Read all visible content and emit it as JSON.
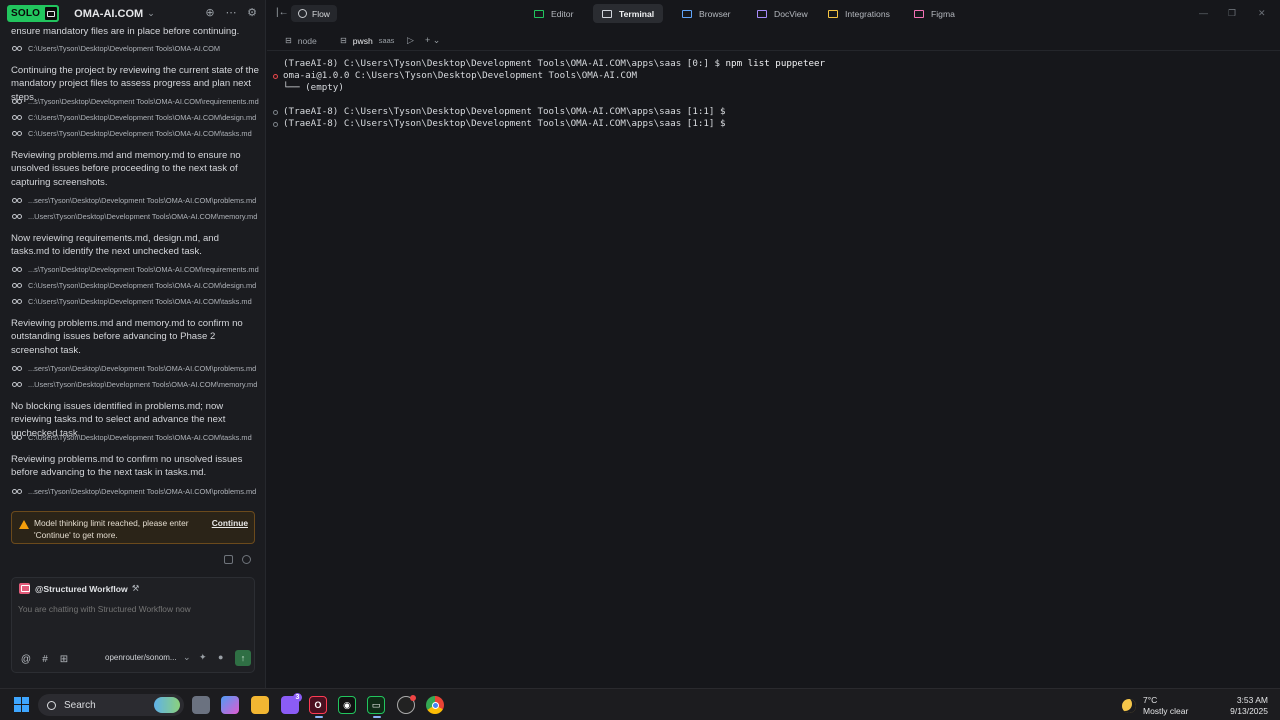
{
  "sidebar": {
    "badge": "SOLO",
    "project": "OMA-AI.COM",
    "messages": [
      {
        "type": "text",
        "text": "ensure mandatory files are in place before continuing."
      },
      {
        "type": "file",
        "path": "C:\\Users\\Tyson\\Desktop\\Development Tools\\OMA-AI.COM"
      },
      {
        "type": "text",
        "text": "Continuing the project by reviewing the current state of the mandatory project files to assess progress and plan next steps."
      },
      {
        "type": "file",
        "path": "...s\\Tyson\\Desktop\\Development Tools\\OMA-AI.COM\\requirements.md"
      },
      {
        "type": "file",
        "path": "C:\\Users\\Tyson\\Desktop\\Development Tools\\OMA-AI.COM\\design.md"
      },
      {
        "type": "file",
        "path": "C:\\Users\\Tyson\\Desktop\\Development Tools\\OMA-AI.COM\\tasks.md"
      },
      {
        "type": "text",
        "text": "Reviewing problems.md and memory.md to ensure no unsolved issues before proceeding to the next task of capturing screenshots."
      },
      {
        "type": "file",
        "path": "...sers\\Tyson\\Desktop\\Development Tools\\OMA-AI.COM\\problems.md"
      },
      {
        "type": "file",
        "path": "...Users\\Tyson\\Desktop\\Development Tools\\OMA-AI.COM\\memory.md"
      },
      {
        "type": "text",
        "text": "Now reviewing requirements.md, design.md, and tasks.md to identify the next unchecked task."
      },
      {
        "type": "file",
        "path": "...s\\Tyson\\Desktop\\Development Tools\\OMA-AI.COM\\requirements.md"
      },
      {
        "type": "file",
        "path": "C:\\Users\\Tyson\\Desktop\\Development Tools\\OMA-AI.COM\\design.md"
      },
      {
        "type": "file",
        "path": "C:\\Users\\Tyson\\Desktop\\Development Tools\\OMA-AI.COM\\tasks.md"
      },
      {
        "type": "text",
        "text": "Reviewing problems.md and memory.md to confirm no outstanding issues before advancing to Phase 2 screenshot task."
      },
      {
        "type": "file",
        "path": "...sers\\Tyson\\Desktop\\Development Tools\\OMA-AI.COM\\problems.md"
      },
      {
        "type": "file",
        "path": "...Users\\Tyson\\Desktop\\Development Tools\\OMA-AI.COM\\memory.md"
      },
      {
        "type": "text",
        "text": "No blocking issues identified in problems.md; now reviewing tasks.md to select and advance the next unchecked task."
      },
      {
        "type": "file",
        "path": "C:\\Users\\Tyson\\Desktop\\Development Tools\\OMA-AI.COM\\tasks.md"
      },
      {
        "type": "text",
        "text": "Reviewing problems.md to confirm no unsolved issues before advancing to the next task in tasks.md."
      },
      {
        "type": "file",
        "path": "...sers\\Tyson\\Desktop\\Development Tools\\OMA-AI.COM\\problems.md"
      }
    ],
    "warning": {
      "text": "Model thinking limit reached, please enter 'Continue' to get more.",
      "button": "Continue"
    },
    "chat": {
      "agent": "@Structured Workflow",
      "placeholder": "You are chatting with Structured Workflow now",
      "model": "openrouter/sonom..."
    }
  },
  "topbar": {
    "flow": "Flow",
    "tabs": [
      {
        "label": "Editor",
        "color": "#22c55e"
      },
      {
        "label": "Terminal",
        "color": "#d1d5db"
      },
      {
        "label": "Browser",
        "color": "#60a5fa"
      },
      {
        "label": "DocView",
        "color": "#a78bfa"
      },
      {
        "label": "Integrations",
        "color": "#f5c542"
      },
      {
        "label": "Figma",
        "color": "#f472b6"
      }
    ],
    "active_tab": "Terminal"
  },
  "terminal": {
    "tabs": [
      {
        "label": "node",
        "sub": ""
      },
      {
        "label": "pwsh",
        "sub": "saas"
      }
    ],
    "lines": [
      {
        "prompt": "(TraeAI-8) C:\\Users\\Tyson\\Desktop\\Development Tools\\OMA-AI.COM\\apps\\saas [0:] $ ",
        "cmd": "npm list puppeteer",
        "dot": ""
      },
      {
        "prompt": "oma-ai@1.0.0 C:\\Users\\Tyson\\Desktop\\Development Tools\\OMA-AI.COM",
        "cmd": "",
        "dot": "err"
      },
      {
        "prompt": "└── (empty)",
        "cmd": "",
        "dot": ""
      },
      {
        "prompt": "",
        "cmd": "",
        "dot": ""
      },
      {
        "prompt": "(TraeAI-8) C:\\Users\\Tyson\\Desktop\\Development Tools\\OMA-AI.COM\\apps\\saas [1:1] $",
        "cmd": "",
        "dot": "ok"
      },
      {
        "prompt": "(TraeAI-8) C:\\Users\\Tyson\\Desktop\\Development Tools\\OMA-AI.COM\\apps\\saas [1:1] $",
        "cmd": "",
        "dot": "ok"
      }
    ]
  },
  "taskbar": {
    "search": "Search",
    "weather_temp": "7°C",
    "weather_desc": "Mostly clear",
    "time": "3:53 AM",
    "date": "9/13/2025",
    "badge_count": "3"
  }
}
